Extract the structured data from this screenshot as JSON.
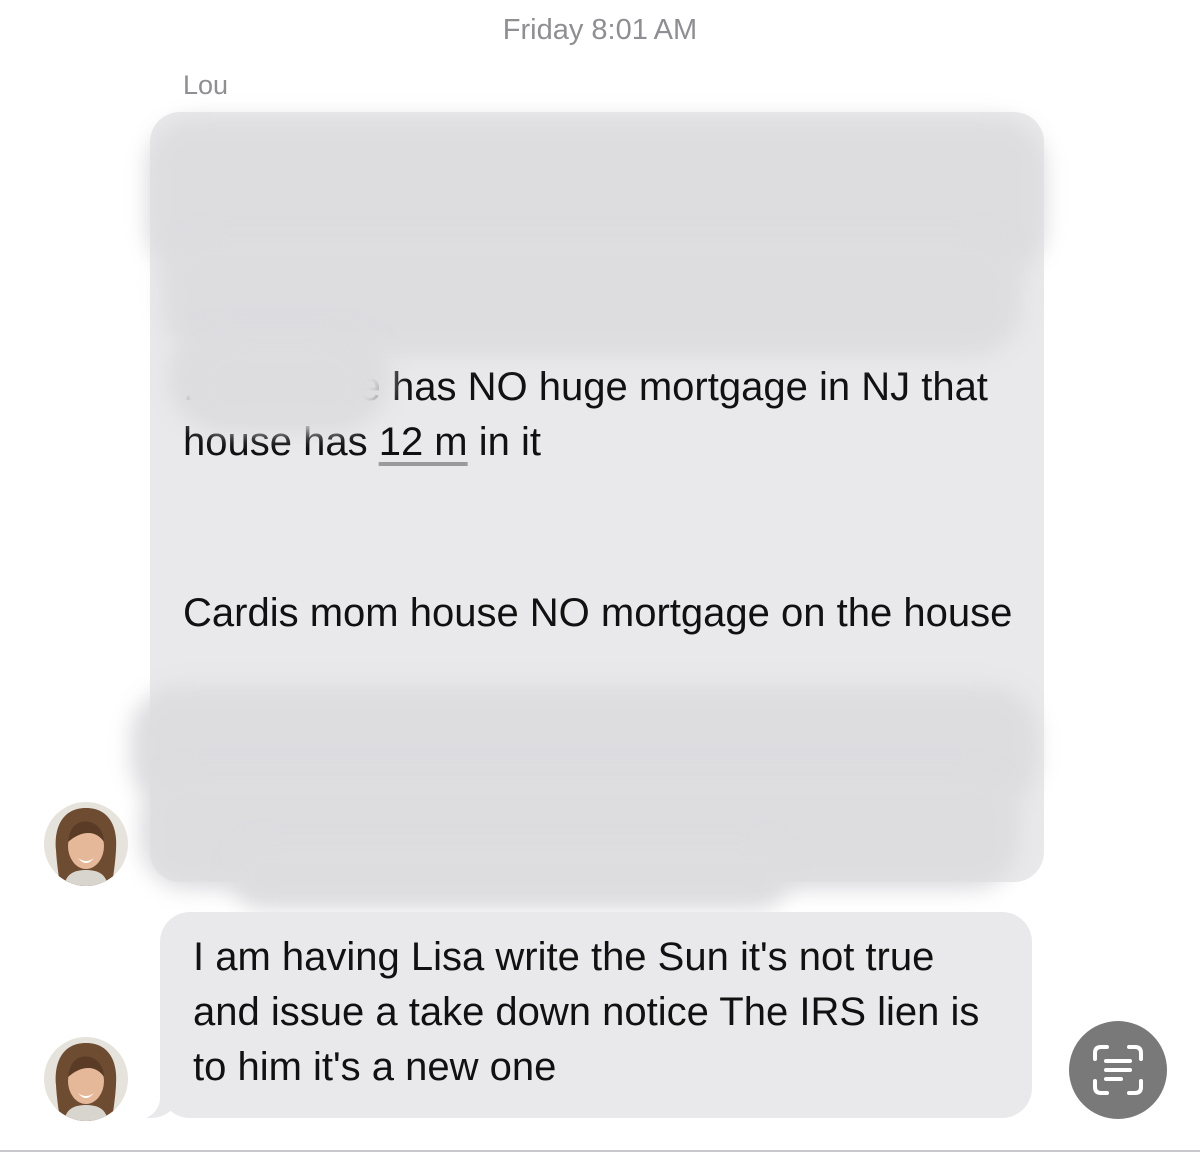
{
  "conversation": {
    "timestamp": "Friday 8:01 AM",
    "sender_name": "Lou",
    "messages": [
      {
        "sender": "Lou",
        "partially_redacted": true,
        "visible_text_1_prefix": ". Again she has NO huge mortgage in NJ that house has ",
        "visible_text_1_link": "12 m",
        "visible_text_1_suffix": " in it",
        "visible_text_2": "Cardis mom house NO mortgage on the house"
      },
      {
        "sender": "Lou",
        "partially_redacted": false,
        "text": "I am having Lisa write the Sun it's not true and issue a take down notice The IRS lien is to him it's a new one"
      }
    ]
  },
  "controls": {
    "live_text_icon": "live-text-icon"
  },
  "colors": {
    "bubble_background": "#e9e9eb",
    "meta_text": "#8e8e93",
    "live_text_button": "#797979"
  }
}
